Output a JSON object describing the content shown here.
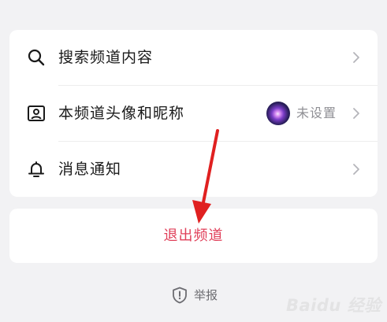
{
  "menu": {
    "items": [
      {
        "label": "搜索频道内容",
        "icon": "search-icon"
      },
      {
        "label": "本频道头像和昵称",
        "icon": "profile-card-icon",
        "value": "未设置"
      },
      {
        "label": "消息通知",
        "icon": "bell-icon"
      }
    ]
  },
  "exit": {
    "label": "退出频道"
  },
  "report": {
    "label": "举报",
    "icon": "shield-icon"
  },
  "watermark": {
    "text": "Baidu 经验"
  },
  "colors": {
    "exit": "#e0405a",
    "arrow": "#e02020",
    "background": "#f2f2f4",
    "card": "#ffffff"
  }
}
